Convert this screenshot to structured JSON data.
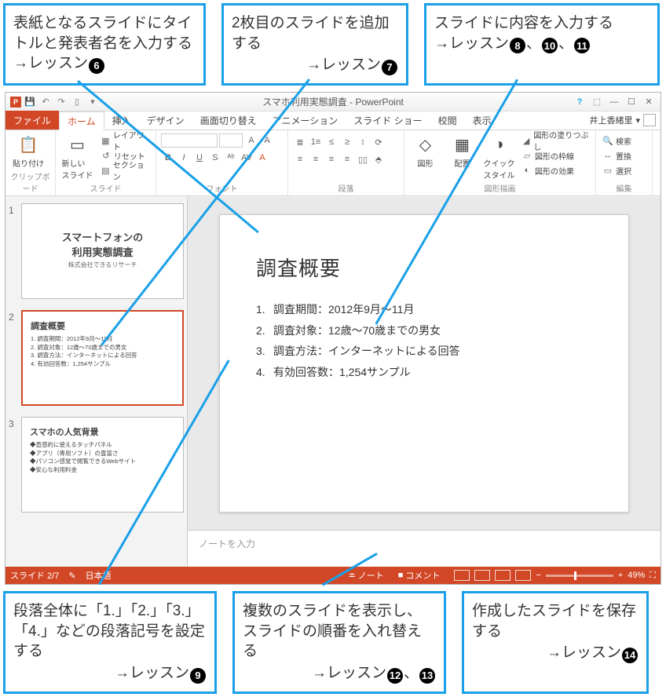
{
  "callouts": {
    "top1": "表紙となるスライドにタイトルと発表者名を入力する →レッスン",
    "top1_num": "6",
    "top2": "2枚目のスライドを追加する",
    "top2_arrow": "→レッスン",
    "top2_num": "7",
    "top3": "スライドに内容を入力する",
    "top3_arrow": "→レッスン",
    "top3_num1": "8",
    "top3_num2": "10",
    "top3_num3": "11",
    "bot1": "段落全体に「1.」「2.」「3.」「4.」などの段落記号を設定する",
    "bot1_arrow": "→レッスン",
    "bot1_num": "9",
    "bot2": "複数のスライドを表示し、スライドの順番を入れ替える",
    "bot2_arrow": "→レッスン",
    "bot2_num1": "12",
    "bot2_num2": "13",
    "bot3": "作成したスライドを保存する",
    "bot3_arrow": "→レッスン",
    "bot3_num": "14"
  },
  "titlebar": {
    "title": "スマホ利用実態調査 - PowerPoint",
    "app_icon": "P"
  },
  "tabs": {
    "file": "ファイル",
    "home": "ホーム",
    "insert": "挿入",
    "design": "デザイン",
    "transition": "画面切り替え",
    "animation": "アニメーション",
    "slideshow": "スライド ショー",
    "review": "校閲",
    "view": "表示",
    "user": "井上香緒里"
  },
  "ribbon": {
    "clipboard": {
      "label": "クリップボード",
      "paste": "貼り付け"
    },
    "slides": {
      "label": "スライド",
      "new": "新しい\nスライド",
      "layout": "レイアウト",
      "reset": "リセット",
      "section": "セクション"
    },
    "font": {
      "label": "フォント"
    },
    "paragraph": {
      "label": "段落"
    },
    "drawing": {
      "label": "図形描画",
      "shapes": "図形",
      "arrange": "配置",
      "quick": "クイック\nスタイル",
      "fill": "図形の塗りつぶし",
      "outline": "図形の枠線",
      "effects": "図形の効果"
    },
    "editing": {
      "label": "編集",
      "find": "検索",
      "replace": "置換",
      "select": "選択"
    }
  },
  "thumbs": {
    "s1_title": "スマートフォンの\n利用実態調査",
    "s1_sub": "株式会社できるリサーチ",
    "s2_title": "調査概要",
    "s2_l1": "1. 調査期間：2012年9月～11月",
    "s2_l2": "2. 調査対象：12歳～70歳までの男女",
    "s2_l3": "3. 調査方法：インターネットによる回答",
    "s2_l4": "4. 有効回答数：1,254サンプル",
    "s3_title": "スマホの人気背景",
    "s3_l1": "◆直感的に使えるタッチパネル",
    "s3_l2": "◆アプリ（専用ソフト）の豊富さ",
    "s3_l3": "◆パソコン感覚で閲覧できるWebサイト",
    "s3_l4": "◆安心な利用料金"
  },
  "main_slide": {
    "title": "調査概要",
    "items": [
      "調査期間：2012年9月～11月",
      "調査対象：12歳～70歳までの男女",
      "調査方法：インターネットによる回答",
      "有効回答数：1,254サンプル"
    ]
  },
  "notes_placeholder": "ノートを入力",
  "statusbar": {
    "slide": "スライド 2/7",
    "lang": "日本語",
    "notes": "ノート",
    "comments": "コメント",
    "zoom": "49%"
  }
}
